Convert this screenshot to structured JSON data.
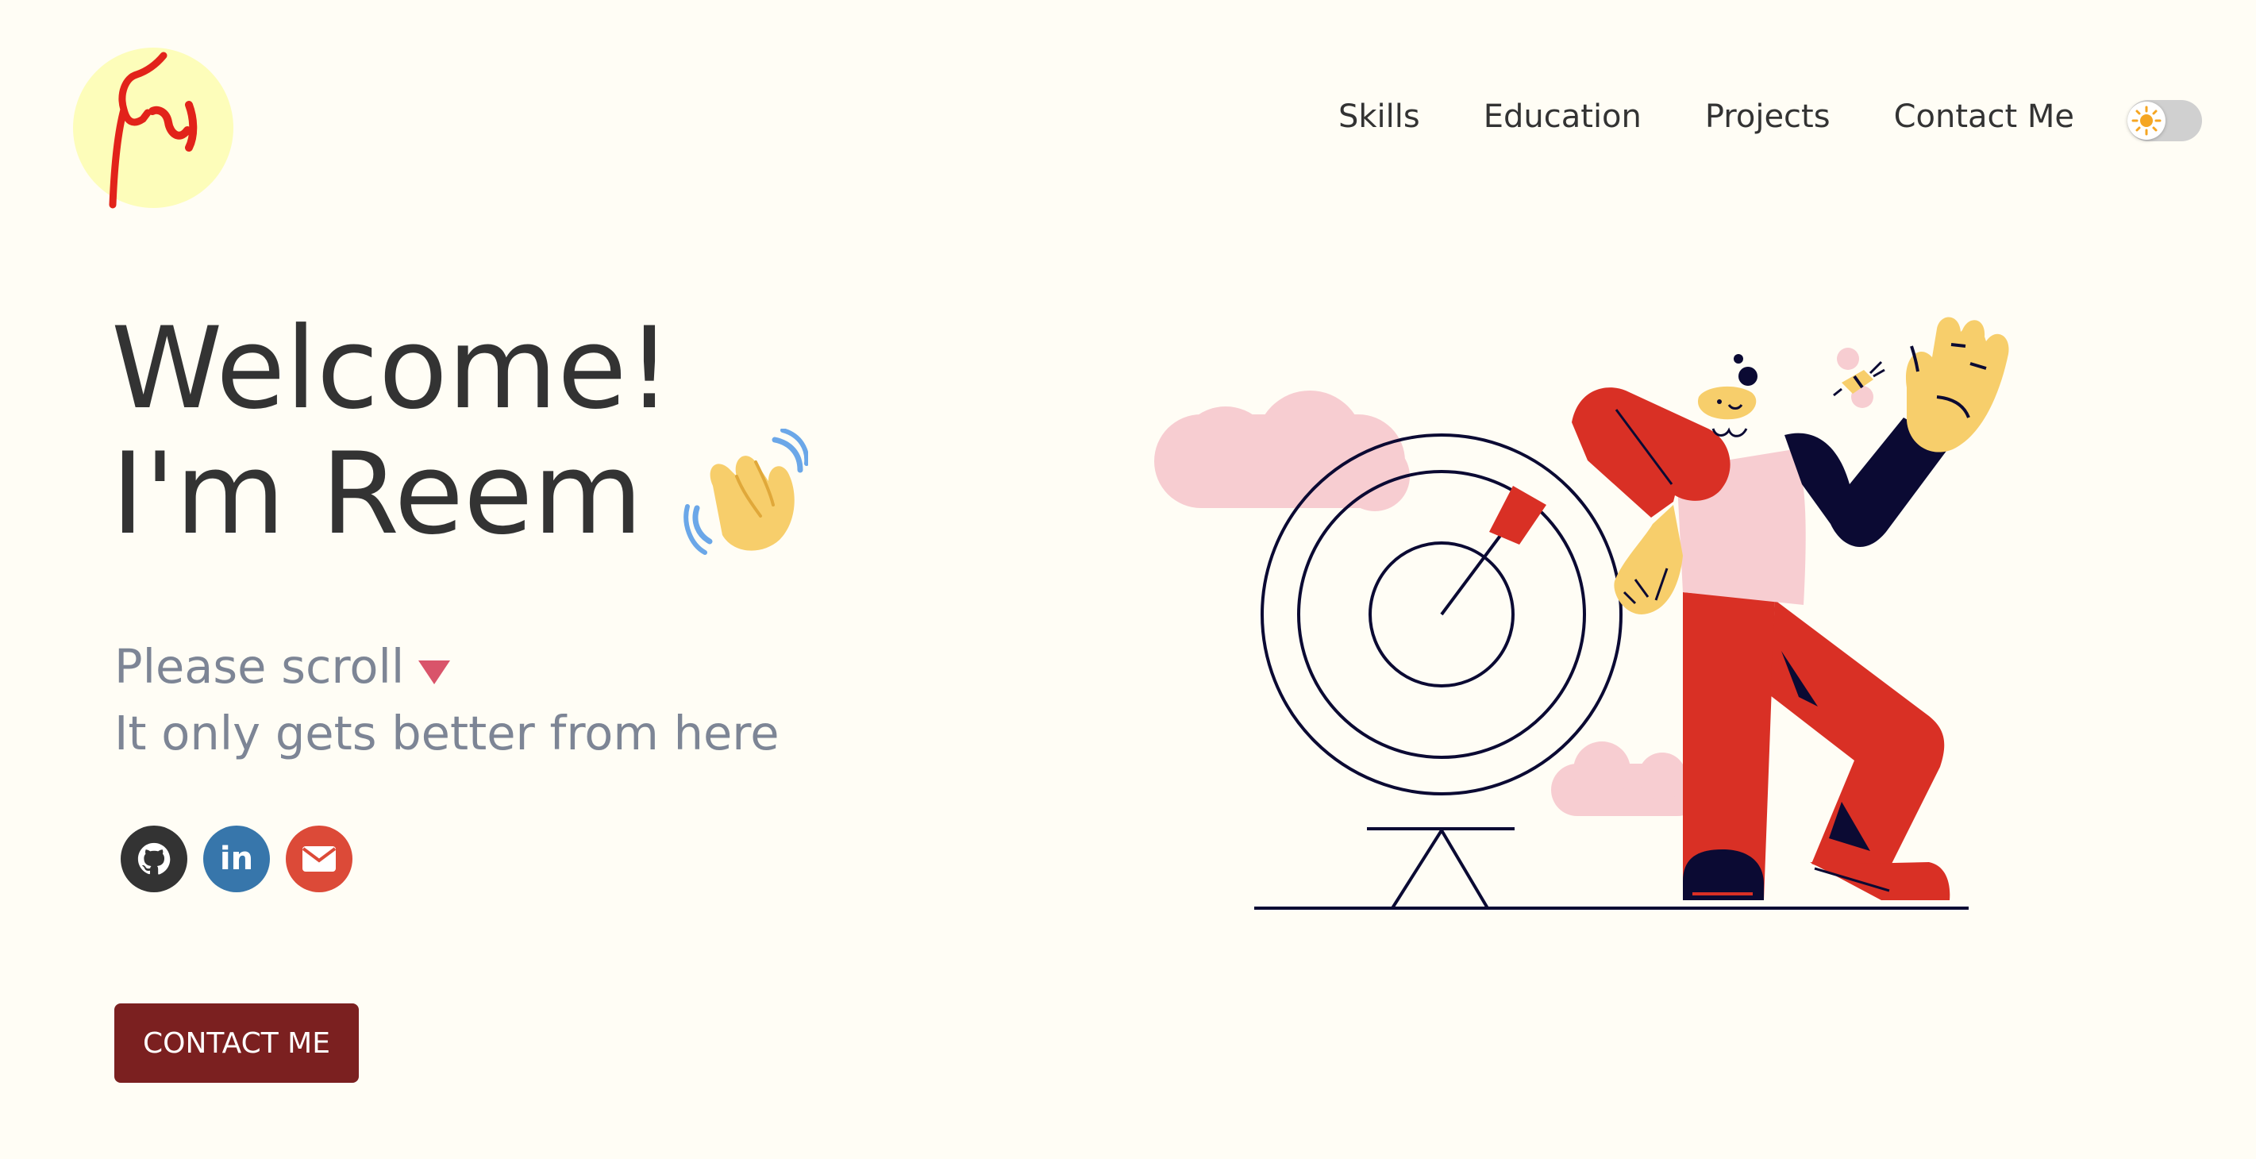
{
  "logo": {
    "glyph": "ريم",
    "bg_color": "#fdfdba",
    "ink_color": "#e2231a"
  },
  "nav": {
    "items": [
      {
        "label": "Skills"
      },
      {
        "label": "Education"
      },
      {
        "label": "Projects"
      },
      {
        "label": "Contact Me"
      }
    ]
  },
  "theme_toggle": {
    "state": "light",
    "icon": "sun-icon"
  },
  "hero": {
    "headline_line1": "Welcome!",
    "headline_line2": "I'm Reem",
    "emoji": "waving-hand-icon",
    "sub_line1": "Please scroll",
    "sub_line2": "It only gets better from here"
  },
  "social": [
    {
      "name": "github-icon",
      "color": "#333333"
    },
    {
      "name": "linkedin-icon",
      "label": "in",
      "color": "#3776ab"
    },
    {
      "name": "email-icon",
      "color": "#dc4a38"
    }
  ],
  "cta": {
    "label": "CONTACT ME",
    "color": "#7b2020"
  },
  "colors": {
    "bg": "#fffdf5",
    "accent_red": "#d93025",
    "pink": "#f7cdd1",
    "navy": "#0b0a33",
    "yellow": "#f7ce6b"
  }
}
